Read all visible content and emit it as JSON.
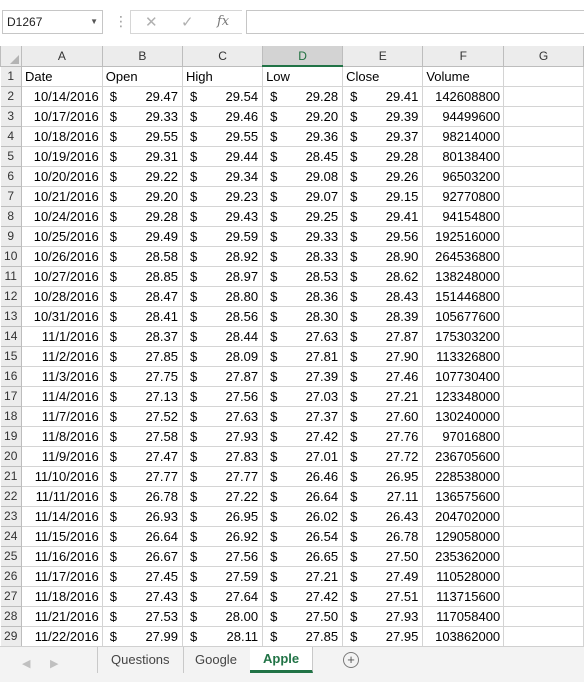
{
  "formula_bar": {
    "name_box": "D1267",
    "name_box_dropdown": "▼",
    "separator": "⋮",
    "cancel_icon": "✕",
    "enter_icon": "✓",
    "function_icon": "fx",
    "formula": ""
  },
  "columns": [
    "A",
    "B",
    "C",
    "D",
    "E",
    "F",
    "G"
  ],
  "selected_column": "D",
  "headers": [
    "Date",
    "Open",
    "High",
    "Low",
    "Close",
    "Volume"
  ],
  "currency": "$",
  "rows": [
    {
      "n": "2",
      "date": "10/14/2016",
      "open": "29.47",
      "high": "29.54",
      "low": "29.28",
      "close": "29.41",
      "volume": "142608800"
    },
    {
      "n": "3",
      "date": "10/17/2016",
      "open": "29.33",
      "high": "29.46",
      "low": "29.20",
      "close": "29.39",
      "volume": "94499600"
    },
    {
      "n": "4",
      "date": "10/18/2016",
      "open": "29.55",
      "high": "29.55",
      "low": "29.36",
      "close": "29.37",
      "volume": "98214000"
    },
    {
      "n": "5",
      "date": "10/19/2016",
      "open": "29.31",
      "high": "29.44",
      "low": "28.45",
      "close": "29.28",
      "volume": "80138400"
    },
    {
      "n": "6",
      "date": "10/20/2016",
      "open": "29.22",
      "high": "29.34",
      "low": "29.08",
      "close": "29.26",
      "volume": "96503200"
    },
    {
      "n": "7",
      "date": "10/21/2016",
      "open": "29.20",
      "high": "29.23",
      "low": "29.07",
      "close": "29.15",
      "volume": "92770800"
    },
    {
      "n": "8",
      "date": "10/24/2016",
      "open": "29.28",
      "high": "29.43",
      "low": "29.25",
      "close": "29.41",
      "volume": "94154800"
    },
    {
      "n": "9",
      "date": "10/25/2016",
      "open": "29.49",
      "high": "29.59",
      "low": "29.33",
      "close": "29.56",
      "volume": "192516000"
    },
    {
      "n": "10",
      "date": "10/26/2016",
      "open": "28.58",
      "high": "28.92",
      "low": "28.33",
      "close": "28.90",
      "volume": "264536800"
    },
    {
      "n": "11",
      "date": "10/27/2016",
      "open": "28.85",
      "high": "28.97",
      "low": "28.53",
      "close": "28.62",
      "volume": "138248000"
    },
    {
      "n": "12",
      "date": "10/28/2016",
      "open": "28.47",
      "high": "28.80",
      "low": "28.36",
      "close": "28.43",
      "volume": "151446800"
    },
    {
      "n": "13",
      "date": "10/31/2016",
      "open": "28.41",
      "high": "28.56",
      "low": "28.30",
      "close": "28.39",
      "volume": "105677600"
    },
    {
      "n": "14",
      "date": "11/1/2016",
      "open": "28.37",
      "high": "28.44",
      "low": "27.63",
      "close": "27.87",
      "volume": "175303200"
    },
    {
      "n": "15",
      "date": "11/2/2016",
      "open": "27.85",
      "high": "28.09",
      "low": "27.81",
      "close": "27.90",
      "volume": "113326800"
    },
    {
      "n": "16",
      "date": "11/3/2016",
      "open": "27.75",
      "high": "27.87",
      "low": "27.39",
      "close": "27.46",
      "volume": "107730400"
    },
    {
      "n": "17",
      "date": "11/4/2016",
      "open": "27.13",
      "high": "27.56",
      "low": "27.03",
      "close": "27.21",
      "volume": "123348000"
    },
    {
      "n": "18",
      "date": "11/7/2016",
      "open": "27.52",
      "high": "27.63",
      "low": "27.37",
      "close": "27.60",
      "volume": "130240000"
    },
    {
      "n": "19",
      "date": "11/8/2016",
      "open": "27.58",
      "high": "27.93",
      "low": "27.42",
      "close": "27.76",
      "volume": "97016800"
    },
    {
      "n": "20",
      "date": "11/9/2016",
      "open": "27.47",
      "high": "27.83",
      "low": "27.01",
      "close": "27.72",
      "volume": "236705600"
    },
    {
      "n": "21",
      "date": "11/10/2016",
      "open": "27.77",
      "high": "27.77",
      "low": "26.46",
      "close": "26.95",
      "volume": "228538000"
    },
    {
      "n": "22",
      "date": "11/11/2016",
      "open": "26.78",
      "high": "27.22",
      "low": "26.64",
      "close": "27.11",
      "volume": "136575600"
    },
    {
      "n": "23",
      "date": "11/14/2016",
      "open": "26.93",
      "high": "26.95",
      "low": "26.02",
      "close": "26.43",
      "volume": "204702000"
    },
    {
      "n": "24",
      "date": "11/15/2016",
      "open": "26.64",
      "high": "26.92",
      "low": "26.54",
      "close": "26.78",
      "volume": "129058000"
    },
    {
      "n": "25",
      "date": "11/16/2016",
      "open": "26.67",
      "high": "27.56",
      "low": "26.65",
      "close": "27.50",
      "volume": "235362000"
    },
    {
      "n": "26",
      "date": "11/17/2016",
      "open": "27.45",
      "high": "27.59",
      "low": "27.21",
      "close": "27.49",
      "volume": "110528000"
    },
    {
      "n": "27",
      "date": "11/18/2016",
      "open": "27.43",
      "high": "27.64",
      "low": "27.42",
      "close": "27.51",
      "volume": "113715600"
    },
    {
      "n": "28",
      "date": "11/21/2016",
      "open": "27.53",
      "high": "28.00",
      "low": "27.50",
      "close": "27.93",
      "volume": "117058400"
    },
    {
      "n": "29",
      "date": "11/22/2016",
      "open": "27.99",
      "high": "28.11",
      "low": "27.85",
      "close": "27.95",
      "volume": "103862000"
    }
  ],
  "sheet_tabs": [
    {
      "label": "Questions",
      "active": false
    },
    {
      "label": "Google",
      "active": false
    },
    {
      "label": "Apple",
      "active": true
    }
  ],
  "tab_nav": {
    "prev": "◀",
    "next": "▶"
  },
  "add_sheet_label": "+",
  "colors": {
    "accent": "#217346",
    "header_bg": "#ececec",
    "grid_line": "#d4d4d4"
  }
}
